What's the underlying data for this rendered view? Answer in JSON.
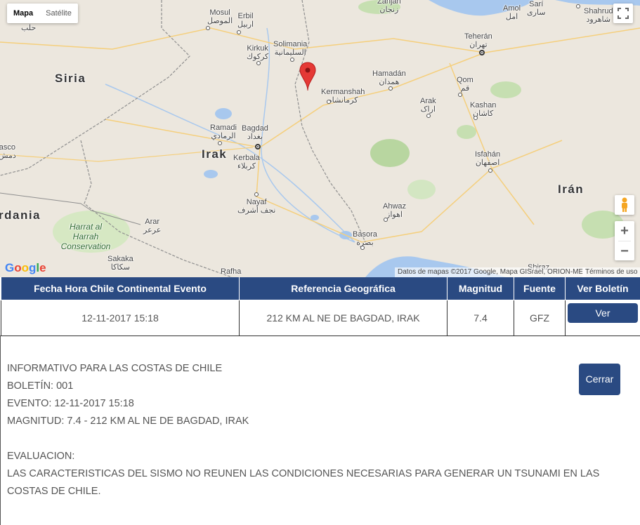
{
  "map": {
    "type_control": {
      "map_label": "Mapa",
      "satellite_label": "Satélite"
    },
    "countries": {
      "syria": "Siria",
      "iraq": "Irak",
      "iran": "Irán",
      "jordan": "rdania"
    },
    "cities": [
      {
        "name": "Mosul",
        "ar": "الموصل"
      },
      {
        "name": "Erbil",
        "ar": "اربيل"
      },
      {
        "name": "Zanjan",
        "ar": "زنجان"
      },
      {
        "name": "Amol",
        "ar": "امل"
      },
      {
        "name": "Sarí",
        "ar": "ساری"
      },
      {
        "name": "Shahrud",
        "ar": "شاهرود"
      },
      {
        "name": "Solimania",
        "ar": "السليمانية"
      },
      {
        "name": "Kirkuk",
        "ar": "كركوك"
      },
      {
        "name": "Teherán",
        "ar": "تهران"
      },
      {
        "name": "Hamadán",
        "ar": "همدان"
      },
      {
        "name": "Kermanshah",
        "ar": "كرمانشاه"
      },
      {
        "name": "Qom",
        "ar": "قم"
      },
      {
        "name": "Arak",
        "ar": "اراک"
      },
      {
        "name": "Kashan",
        "ar": "کاشان"
      },
      {
        "name": "Ramadi",
        "ar": "الرمادي"
      },
      {
        "name": "Bagdad",
        "ar": "بغداد"
      },
      {
        "name": "Kerbala",
        "ar": "كربلاء"
      },
      {
        "name": "Isfahán",
        "ar": "اصفهان"
      },
      {
        "name": "Nayaf",
        "ar": "نجف أشرف"
      },
      {
        "name": "Ahwaz",
        "ar": "اهواز"
      },
      {
        "name": "Arar",
        "ar": "عرعر"
      },
      {
        "name": "Basora",
        "ar": "بصرة"
      },
      {
        "name": "Sakaka",
        "ar": "سكاكا"
      },
      {
        "name": "Rafha",
        "ar": ""
      },
      {
        "name": "Shiraz",
        "ar": ""
      },
      {
        "name": "asco",
        "ar": "دمش"
      },
      {
        "name": "",
        "ar": "حلب"
      }
    ],
    "park": "Harrat al Harrah Conservation",
    "google_logo": "Google",
    "attribution": "Datos de mapas ©2017 Google, Mapa GISrael, ORION-ME",
    "terms": "Términos de uso"
  },
  "table": {
    "headers": [
      "Fecha Hora Chile Continental Evento",
      "Referencia Geográfica",
      "Magnitud",
      "Fuente",
      "Ver Boletín"
    ],
    "rows": [
      {
        "fecha": "12-11-2017 15:18",
        "referencia": "212 KM AL NE DE BAGDAD, IRAK",
        "magnitud": "7.4",
        "fuente": "GFZ",
        "ver_label": "Ver"
      }
    ]
  },
  "bulletin": {
    "lines": [
      "INFORMATIVO PARA LAS COSTAS DE CHILE",
      "BOLETÍN: 001",
      "EVENTO: 12-11-2017 15:18",
      "MAGNITUD: 7.4 - 212 KM AL NE DE BAGDAD, IRAK"
    ],
    "evaluation_title": "EVALUACION:",
    "evaluation_text_1": "LAS CARACTERISTICAS DEL SISMO NO REUNEN LAS CONDICIONES NECESARIAS PARA GENERAR UN TSUNAMI EN LAS",
    "evaluation_text_2": "COSTAS DE CHILE.",
    "close_label": "Cerrar"
  },
  "colors": {
    "header_bg": "#2a4a82",
    "button_bg": "#2a4a82",
    "marker": "#e53935"
  }
}
